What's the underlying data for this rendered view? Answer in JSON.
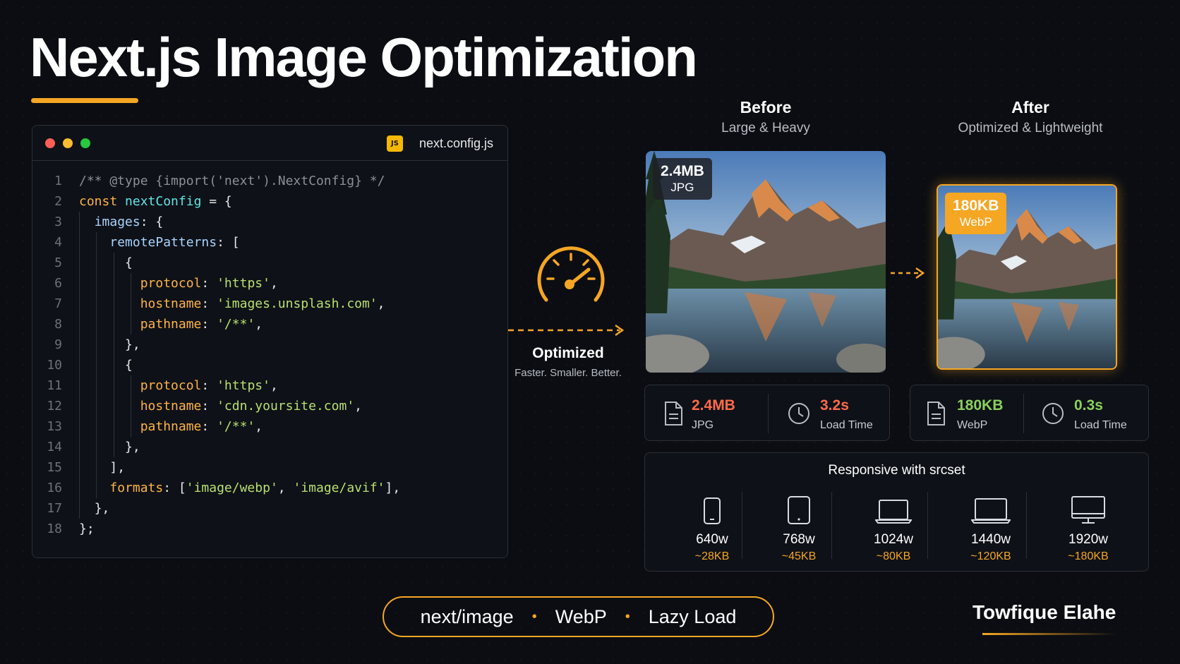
{
  "title": "Next.js Image Optimization",
  "colors": {
    "accent": "#f5a623",
    "background": "#0b0d12",
    "red": "#ff6b4a",
    "green": "#8ad05c"
  },
  "code_window": {
    "filename": "next.config.js",
    "file_badge": "JS",
    "lines": [
      {
        "n": "1",
        "indent": 0,
        "segments": [
          {
            "t": "/** @type {import('next').NextConfig} */",
            "c": "comment"
          }
        ]
      },
      {
        "n": "2",
        "indent": 0,
        "segments": [
          {
            "t": "const ",
            "c": "kw"
          },
          {
            "t": "nextConfig",
            "c": "var"
          },
          {
            "t": " = {",
            "c": "punc"
          }
        ]
      },
      {
        "n": "3",
        "indent": 1,
        "segments": [
          {
            "t": "images",
            "c": "prop"
          },
          {
            "t": ": {",
            "c": "punc"
          }
        ]
      },
      {
        "n": "4",
        "indent": 2,
        "segments": [
          {
            "t": "remotePatterns",
            "c": "prop"
          },
          {
            "t": ": [",
            "c": "punc"
          }
        ]
      },
      {
        "n": "5",
        "indent": 3,
        "segments": [
          {
            "t": "{",
            "c": "punc"
          }
        ]
      },
      {
        "n": "6",
        "indent": 4,
        "segments": [
          {
            "t": "protocol",
            "c": "prop2"
          },
          {
            "t": ": ",
            "c": "punc"
          },
          {
            "t": "'https'",
            "c": "str"
          },
          {
            "t": ",",
            "c": "punc"
          }
        ]
      },
      {
        "n": "7",
        "indent": 4,
        "segments": [
          {
            "t": "hostname",
            "c": "prop2"
          },
          {
            "t": ": ",
            "c": "punc"
          },
          {
            "t": "'images.unsplash.com'",
            "c": "str"
          },
          {
            "t": ",",
            "c": "punc"
          }
        ]
      },
      {
        "n": "8",
        "indent": 4,
        "segments": [
          {
            "t": "pathname",
            "c": "prop2"
          },
          {
            "t": ": ",
            "c": "punc"
          },
          {
            "t": "'/**'",
            "c": "str"
          },
          {
            "t": ",",
            "c": "punc"
          }
        ]
      },
      {
        "n": "9",
        "indent": 3,
        "segments": [
          {
            "t": "},",
            "c": "punc"
          }
        ]
      },
      {
        "n": "10",
        "indent": 3,
        "segments": [
          {
            "t": "{",
            "c": "punc"
          }
        ]
      },
      {
        "n": "11",
        "indent": 4,
        "segments": [
          {
            "t": "protocol",
            "c": "prop2"
          },
          {
            "t": ": ",
            "c": "punc"
          },
          {
            "t": "'https'",
            "c": "str"
          },
          {
            "t": ",",
            "c": "punc"
          }
        ]
      },
      {
        "n": "12",
        "indent": 4,
        "segments": [
          {
            "t": "hostname",
            "c": "prop2"
          },
          {
            "t": ": ",
            "c": "punc"
          },
          {
            "t": "'cdn.yoursite.com'",
            "c": "str"
          },
          {
            "t": ",",
            "c": "punc"
          }
        ]
      },
      {
        "n": "13",
        "indent": 4,
        "segments": [
          {
            "t": "pathname",
            "c": "prop2"
          },
          {
            "t": ": ",
            "c": "punc"
          },
          {
            "t": "'/**'",
            "c": "str"
          },
          {
            "t": ",",
            "c": "punc"
          }
        ]
      },
      {
        "n": "14",
        "indent": 3,
        "segments": [
          {
            "t": "},",
            "c": "punc"
          }
        ]
      },
      {
        "n": "15",
        "indent": 2,
        "segments": [
          {
            "t": "],",
            "c": "punc"
          }
        ]
      },
      {
        "n": "16",
        "indent": 2,
        "segments": [
          {
            "t": "formats",
            "c": "prop2"
          },
          {
            "t": ": [",
            "c": "punc"
          },
          {
            "t": "'image/webp'",
            "c": "str"
          },
          {
            "t": ", ",
            "c": "punc"
          },
          {
            "t": "'image/avif'",
            "c": "str"
          },
          {
            "t": "],",
            "c": "punc"
          }
        ]
      },
      {
        "n": "17",
        "indent": 1,
        "segments": [
          {
            "t": "},",
            "c": "punc"
          }
        ]
      },
      {
        "n": "18",
        "indent": 0,
        "segments": [
          {
            "t": "};",
            "c": "punc"
          }
        ]
      }
    ]
  },
  "optimized": {
    "label": "Optimized",
    "sub": "Faster. Smaller. Better."
  },
  "before": {
    "heading": "Before",
    "sub": "Large & Heavy",
    "badge_size": "2.4MB",
    "badge_format": "JPG",
    "stat_size": "2.4MB",
    "stat_format": "JPG",
    "stat_time": "3.2s",
    "stat_time_label": "Load Time"
  },
  "after": {
    "heading": "After",
    "sub": "Optimized & Lightweight",
    "badge_size": "180KB",
    "badge_format": "WebP",
    "stat_size": "180KB",
    "stat_format": "WebP",
    "stat_time": "0.3s",
    "stat_time_label": "Load Time"
  },
  "responsive": {
    "title": "Responsive with srcset",
    "items": [
      {
        "icon": "phone-icon",
        "width": "640w",
        "size": "~28KB"
      },
      {
        "icon": "tablet-icon",
        "width": "768w",
        "size": "~45KB"
      },
      {
        "icon": "laptop-icon",
        "width": "1024w",
        "size": "~80KB"
      },
      {
        "icon": "laptop-icon",
        "width": "1440w",
        "size": "~120KB"
      },
      {
        "icon": "monitor-icon",
        "width": "1920w",
        "size": "~180KB"
      }
    ]
  },
  "pill": {
    "items": [
      "next/image",
      "WebP",
      "Lazy Load"
    ],
    "separator": "•"
  },
  "author": "Towfique Elahe"
}
